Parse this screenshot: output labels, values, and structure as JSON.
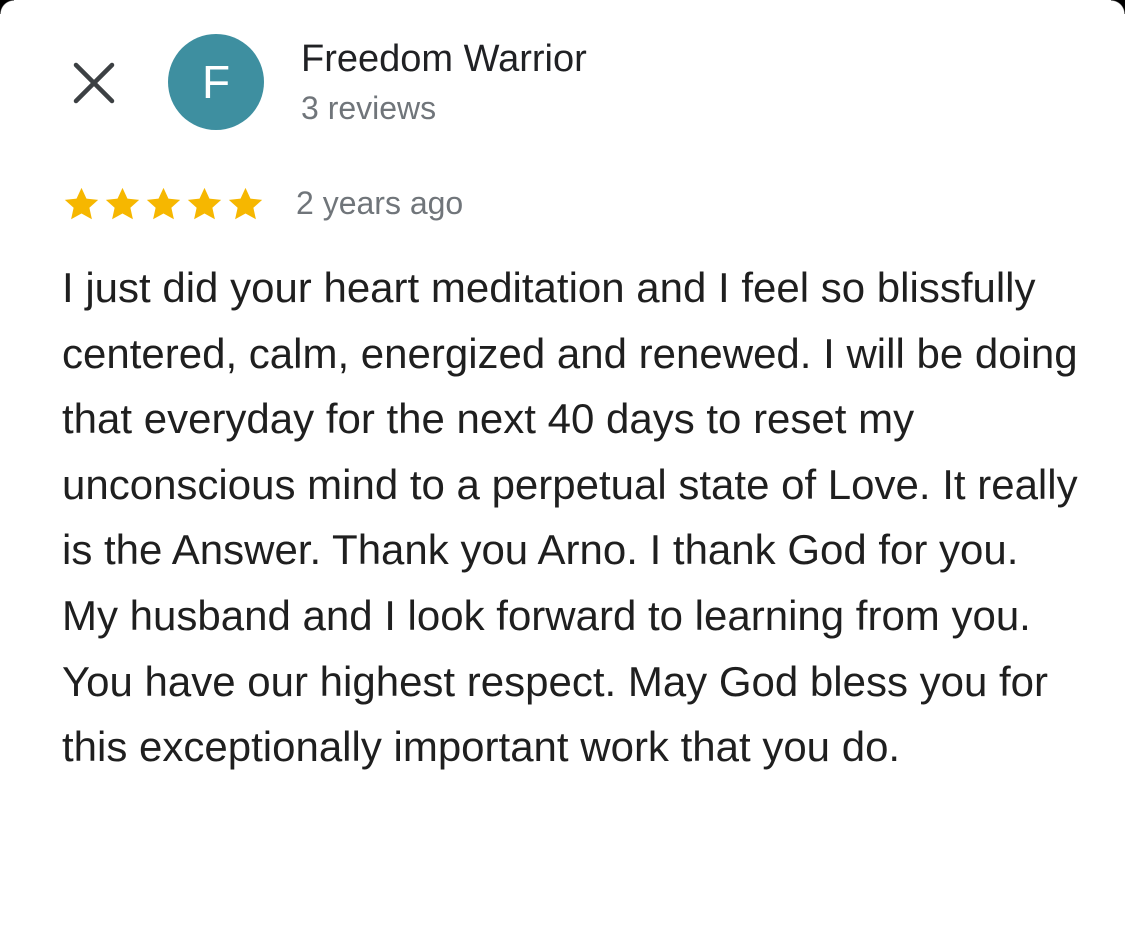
{
  "close": {
    "icon": "close-icon"
  },
  "reviewer": {
    "avatar_initial": "F",
    "avatar_color": "#3e8fa0",
    "name": "Freedom Warrior",
    "review_count": "3 reviews"
  },
  "review": {
    "rating": 5,
    "rating_max": 5,
    "star_color": "#f6b700",
    "date": "2 years ago",
    "text": "I just did your heart meditation and I feel so blissfully centered, calm, energized and renewed. I will be doing that everyday for the next 40 days to reset my unconscious mind to a perpetual state of Love. It really is the Answer. Thank you Arno. I thank God for you. My husband and I look forward to learning from you. You have our highest respect. May God bless you for this exceptionally important work that you do."
  }
}
